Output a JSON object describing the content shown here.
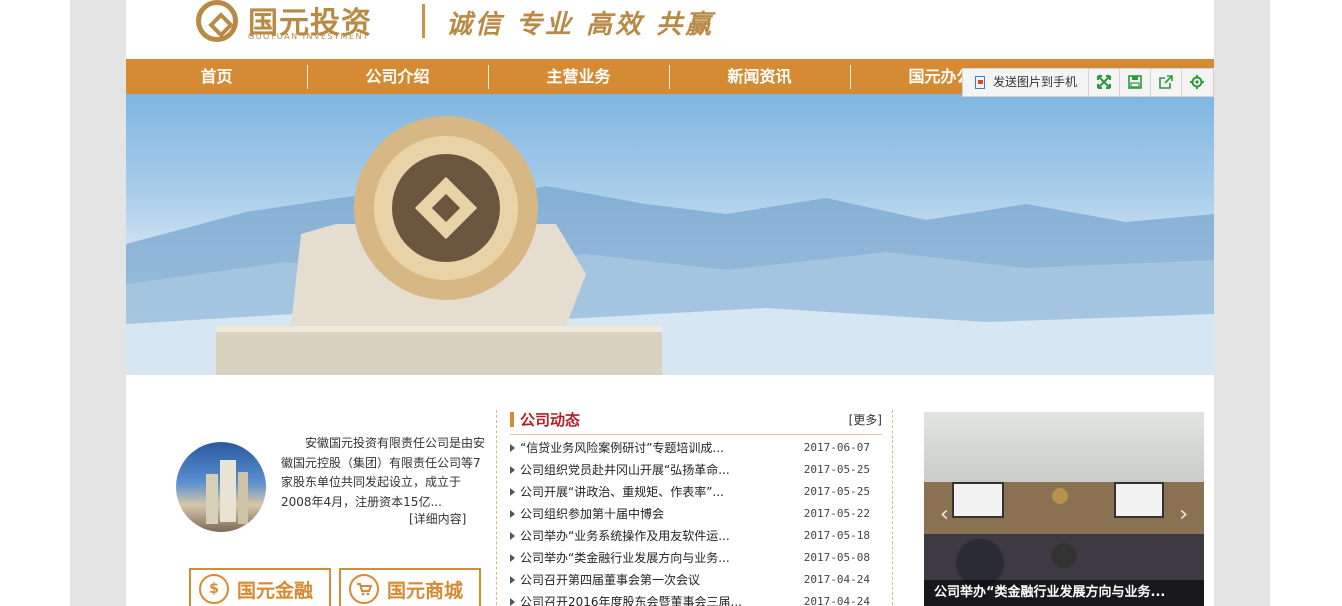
{
  "header": {
    "logo_cn": "国元投资",
    "logo_en": "GUOYUAN INVESTMENT",
    "slogan": "诚信 专业 高效 共赢"
  },
  "nav": [
    {
      "label": "首页"
    },
    {
      "label": "公司介绍"
    },
    {
      "label": "主营业务"
    },
    {
      "label": "新闻资讯"
    },
    {
      "label": "国元办公"
    }
  ],
  "toolbar": {
    "send_label": "发送图片到手机",
    "icons": [
      "expand-icon",
      "save-icon",
      "share-icon",
      "settings-icon"
    ]
  },
  "intro": {
    "text": "安徽国元投资有限责任公司是由安徽国元控股（集团）有限责任公司等7家股东单位共同发起设立，成立于2008年4月，注册资本15亿...",
    "more": "[详细内容]"
  },
  "cards": [
    {
      "label": "国元金融",
      "icon": "$"
    },
    {
      "label": "国元商城",
      "icon": "cart-icon"
    }
  ],
  "news": {
    "title": "公司动态",
    "more": "[更多]",
    "items": [
      {
        "title": "“信贷业务风险案例研讨”专题培训成...",
        "date": "2017-06-07"
      },
      {
        "title": "公司组织党员赴井冈山开展“弘扬革命...",
        "date": "2017-05-25"
      },
      {
        "title": "公司开展“讲政治、重规矩、作表率”...",
        "date": "2017-05-25"
      },
      {
        "title": "公司组织参加第十届中博会",
        "date": "2017-05-22"
      },
      {
        "title": "公司举办“业务系统操作及用友软件运...",
        "date": "2017-05-18"
      },
      {
        "title": "公司举办“类金融行业发展方向与业务...",
        "date": "2017-05-08"
      },
      {
        "title": "公司召开第四届董事会第一次会议",
        "date": "2017-04-24"
      },
      {
        "title": "公司召开2016年度股东会暨董事会三届...",
        "date": "2017-04-24"
      }
    ]
  },
  "photo": {
    "caption": "公司举办“类金融行业发展方向与业务..."
  },
  "colors": {
    "accent": "#d48b34",
    "gold": "#b88a46",
    "news_title": "#b0202a"
  }
}
